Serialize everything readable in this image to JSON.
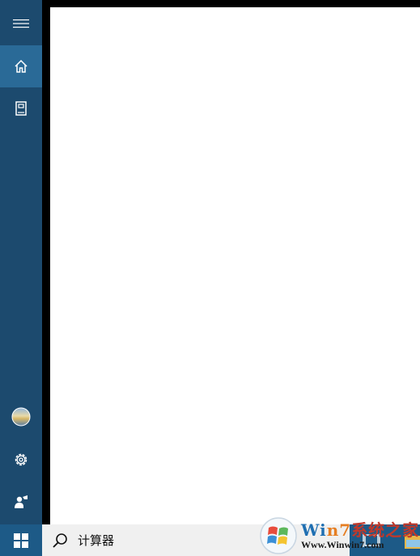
{
  "sidebar": {
    "items": [
      {
        "name": "hamburger-menu-icon"
      },
      {
        "name": "home-icon"
      },
      {
        "name": "notebook-icon"
      },
      {
        "name": "user-avatar-icon"
      },
      {
        "name": "settings-gear-icon"
      },
      {
        "name": "feedback-icon"
      }
    ],
    "colors": {
      "background": "#1c4a6e",
      "active": "#2a6a97"
    }
  },
  "taskbar": {
    "search": {
      "text": "计算器"
    }
  },
  "watermark": {
    "title_prefix": "Wi",
    "title_seven": "n7",
    "title_suffix": "系统之家",
    "url": "Www.Winwin7.com"
  }
}
